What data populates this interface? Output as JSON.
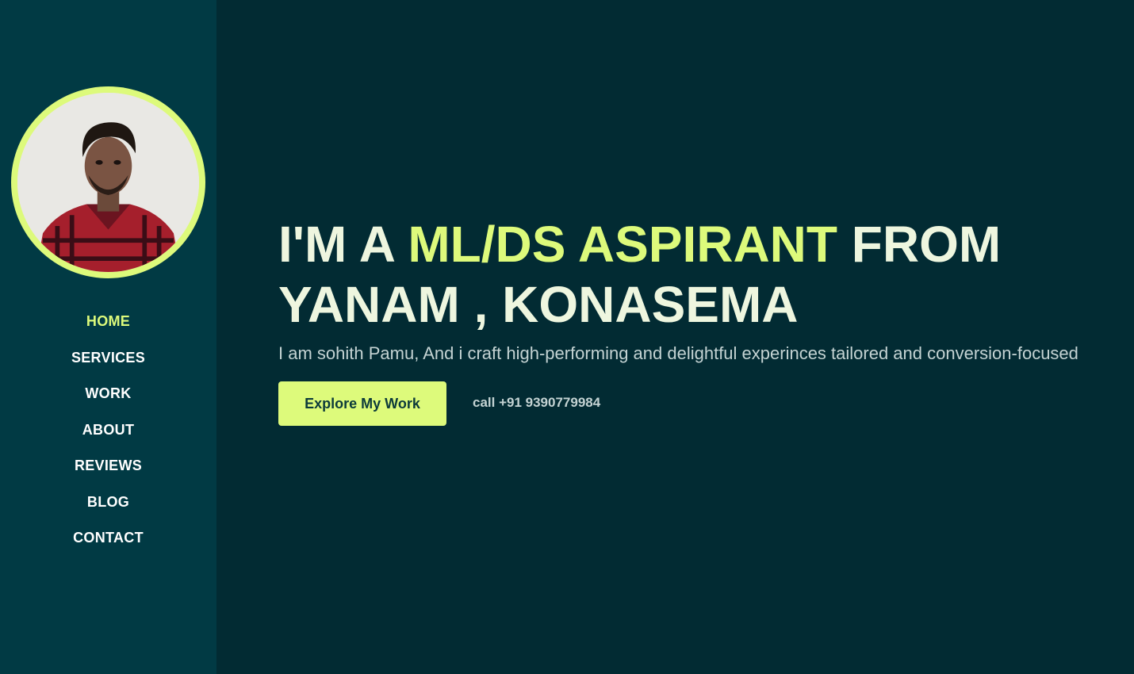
{
  "colors": {
    "background": "#022b33",
    "sidebar": "#013a44",
    "accent": "#ddfa7b",
    "heading": "#eef6df",
    "muted_text": "#c4d3d3"
  },
  "sidebar": {
    "avatar_icon": "profile-photo",
    "nav": [
      {
        "label": "HOME",
        "active": true
      },
      {
        "label": "SERVICES",
        "active": false
      },
      {
        "label": "WORK",
        "active": false
      },
      {
        "label": "ABOUT",
        "active": false
      },
      {
        "label": "REVIEWS",
        "active": false
      },
      {
        "label": "BLOG",
        "active": false
      },
      {
        "label": "CONTACT",
        "active": false
      }
    ]
  },
  "hero": {
    "title_prefix": "I'M A ",
    "title_accent": "ML/DS ASPIRANT",
    "title_middle": " FROM",
    "title_line2": "YANAM , KONASEMA",
    "subtitle": "I am sohith Pamu, And i craft high-performing and delightful experinces tailored and conversion-focused",
    "cta_label": "Explore My Work",
    "call_text": "call +91 9390779984"
  }
}
